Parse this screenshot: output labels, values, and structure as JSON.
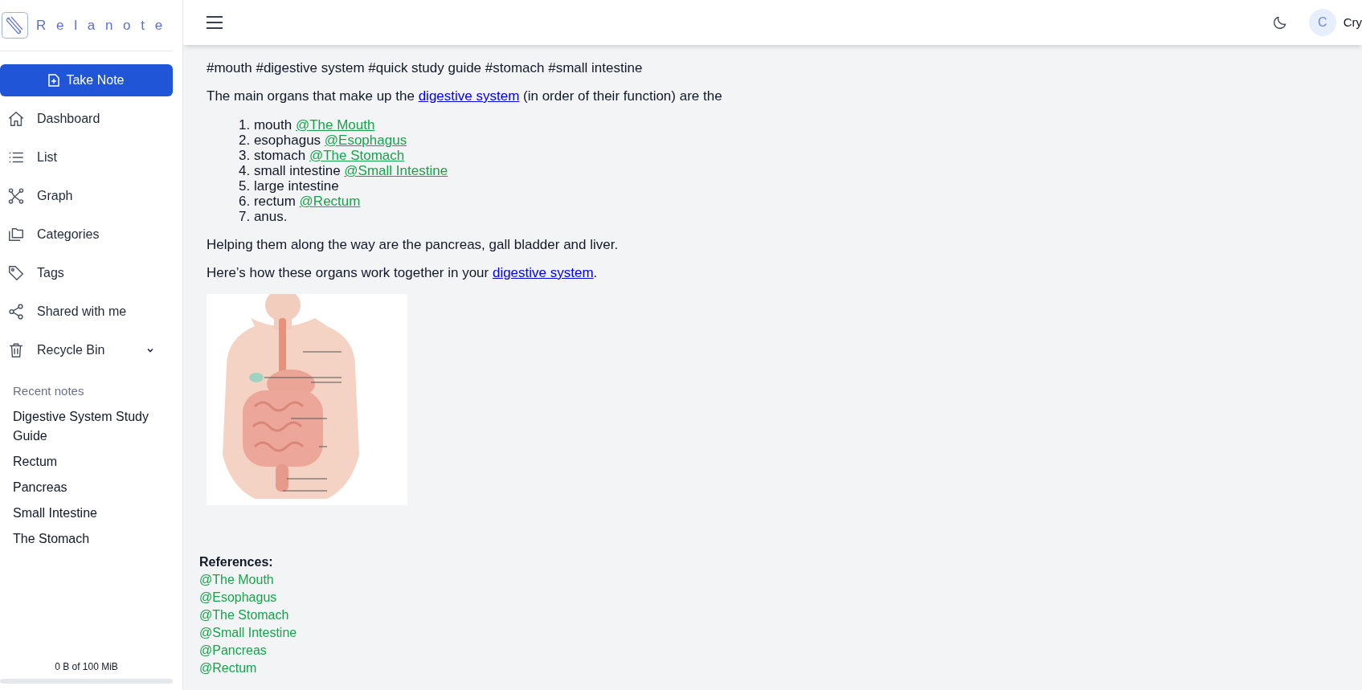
{
  "brand": {
    "name": "Relanote"
  },
  "sidebar": {
    "primary_button": "Take Note",
    "items": [
      {
        "label": "Dashboard"
      },
      {
        "label": "List"
      },
      {
        "label": "Graph"
      },
      {
        "label": "Categories"
      },
      {
        "label": "Tags"
      },
      {
        "label": "Shared with me"
      },
      {
        "label": "Recycle Bin",
        "expanded": false
      }
    ],
    "recent_title": "Recent notes",
    "recent_notes": [
      "Digestive System Study Guide",
      "Rectum",
      "Pancreas",
      "Small Intestine",
      "The Stomach"
    ],
    "storage": {
      "text": "0 B of 100 MiB"
    }
  },
  "header": {
    "avatar_letter": "C",
    "user_name": "Cry"
  },
  "note": {
    "blocks": [
      {
        "kind": "paragraph",
        "parts": [
          {
            "kind": "text",
            "text": "#mouth #digestive system #quick study guide #stomach #small intestine"
          }
        ]
      },
      {
        "kind": "paragraph",
        "parts": [
          {
            "kind": "text",
            "text": "The main organs that make up the "
          },
          {
            "kind": "link",
            "text": "digestive system"
          },
          {
            "kind": "text",
            "text": " (in order of their function) are the"
          }
        ]
      },
      {
        "kind": "list",
        "items": [
          {
            "number": "1.",
            "text": "mouth",
            "mention": "@The Mouth"
          },
          {
            "number": "2.",
            "text": "esophagus",
            "mention": "@Esophagus"
          },
          {
            "number": "3.",
            "text": "stomach",
            "mention": "@The Stomach"
          },
          {
            "number": "4.",
            "text": "small intestine",
            "mention": "@Small Intestine"
          },
          {
            "number": "5.",
            "text": "large intestine"
          },
          {
            "number": "6.",
            "text": "rectum",
            "mention": "@Rectum"
          },
          {
            "number": "7.",
            "text": "anus."
          }
        ]
      },
      {
        "kind": "paragraph",
        "parts": [
          {
            "kind": "text",
            "text": "Helping them along the way are the pancreas, gall bladder and liver."
          }
        ]
      },
      {
        "kind": "paragraph",
        "parts": [
          {
            "kind": "text",
            "text": "Here’s how these organs work together in your "
          },
          {
            "kind": "link",
            "text": "digestive system"
          },
          {
            "kind": "text",
            "text": "."
          }
        ]
      },
      {
        "kind": "picture"
      }
    ],
    "references": {
      "title": "References:",
      "items": [
        "@The Mouth",
        "@Esophagus",
        "@The Stomach",
        "@Small Intestine",
        "@Pancreas",
        "@Rectum"
      ]
    }
  }
}
